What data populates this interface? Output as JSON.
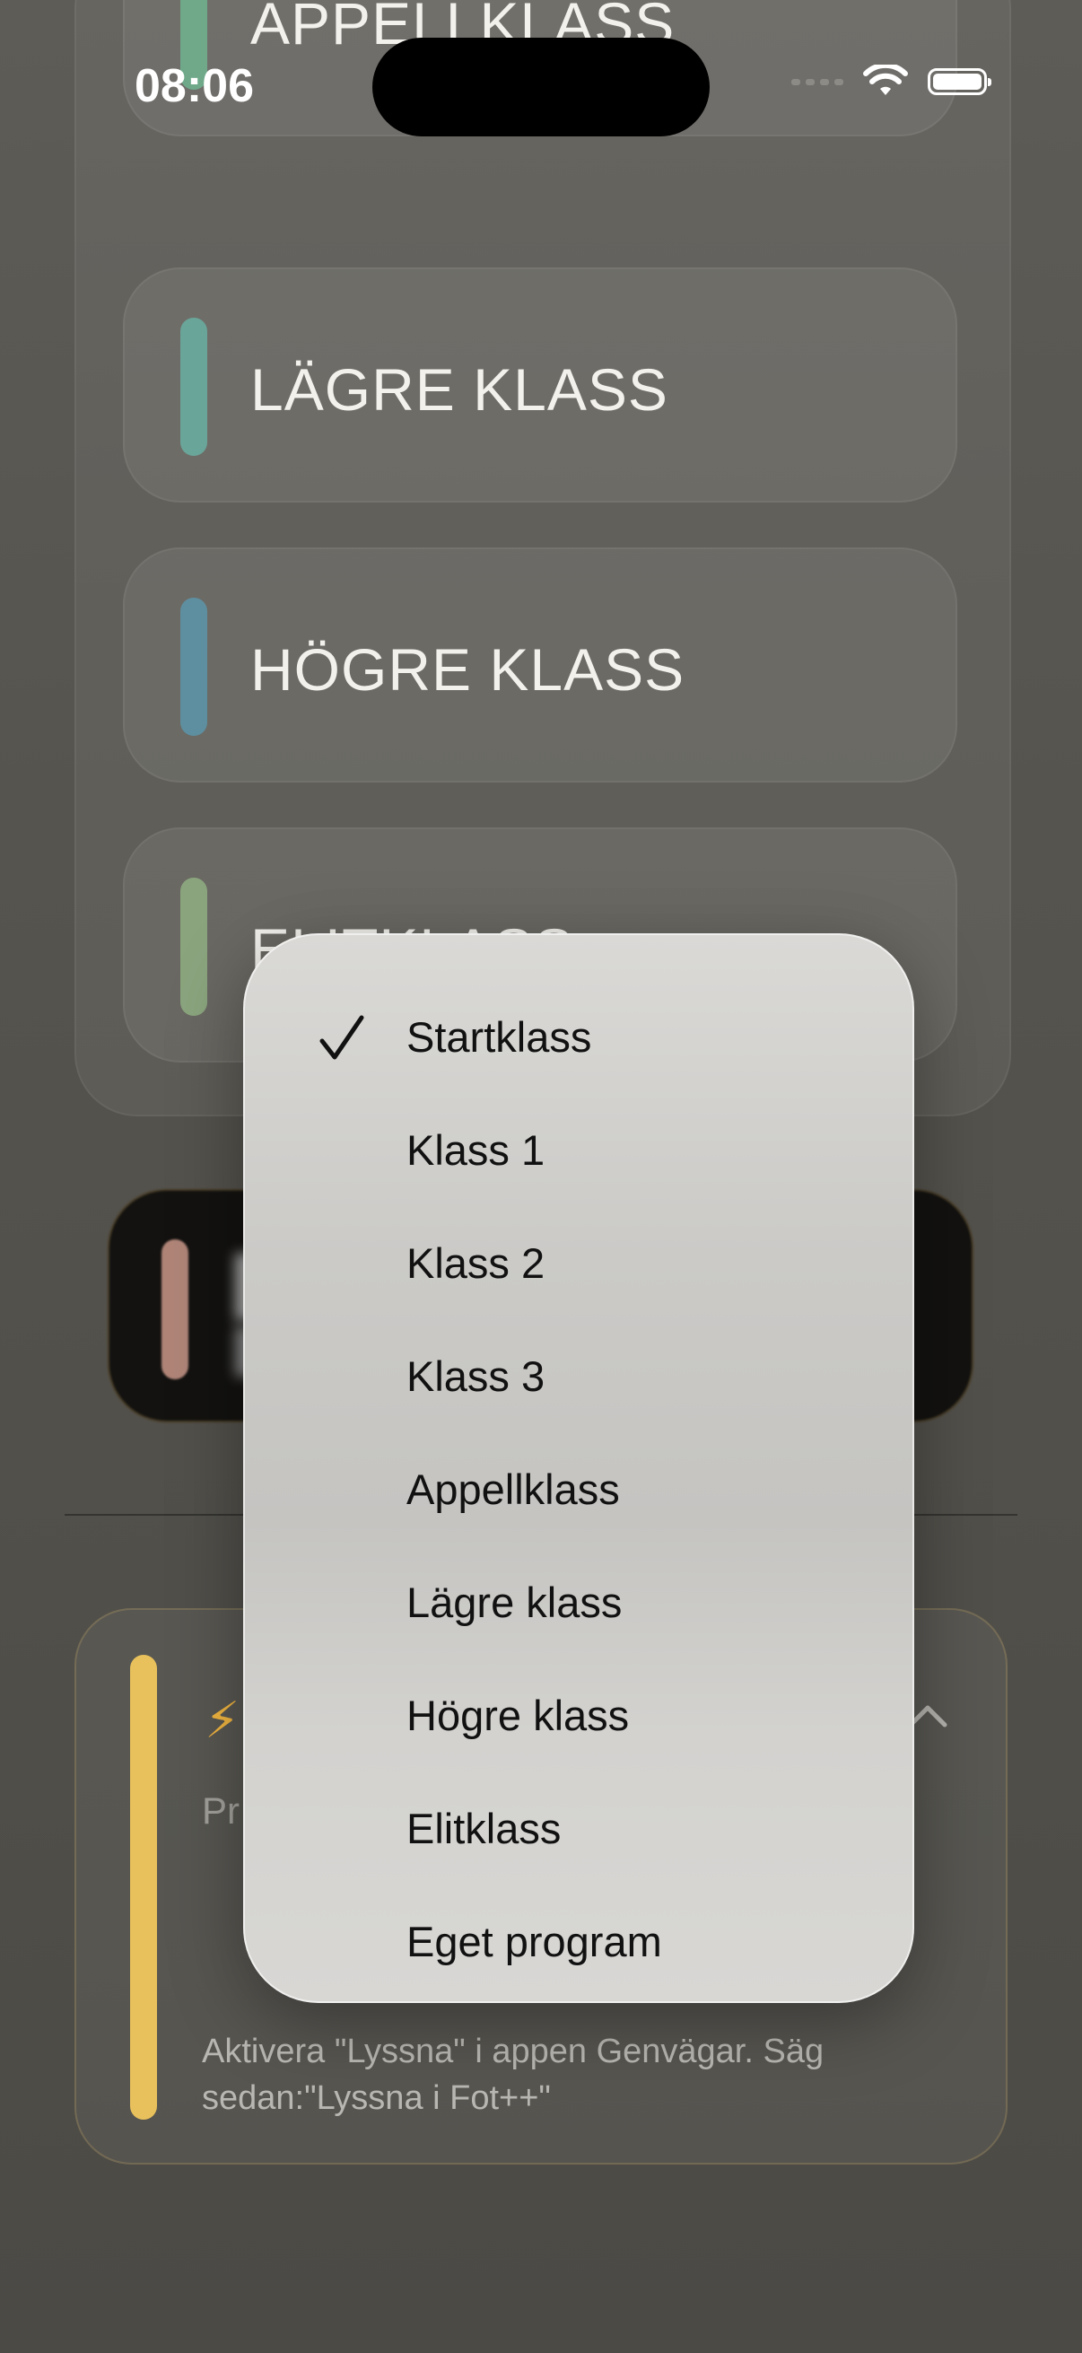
{
  "status_bar": {
    "time": "08:06"
  },
  "class_cards": [
    {
      "title": "APPELLKLASS",
      "color": "#6fa98a"
    },
    {
      "title": "LÄGRE KLASS",
      "color": "#6aa59a"
    },
    {
      "title": "HÖGRE KLASS",
      "color": "#5e8fa0"
    },
    {
      "title": "ELITKLASS",
      "color": "#8aa57e"
    }
  ],
  "dark_card": {
    "color": "#b08578"
  },
  "info_card": {
    "icon": "bolt-icon",
    "partial_label": "Pr",
    "text": "Aktivera \"Lyssna\" i appen Genvägar. Säg sedan:\"Lyssna i Fot++\"",
    "color": "#e8c15c"
  },
  "menu": {
    "selected": "Startklass",
    "items": [
      "Startklass",
      "Klass 1",
      "Klass 2",
      "Klass 3",
      "Appellklass",
      "Lägre klass",
      "Högre klass",
      "Elitklass",
      "Eget program"
    ]
  }
}
